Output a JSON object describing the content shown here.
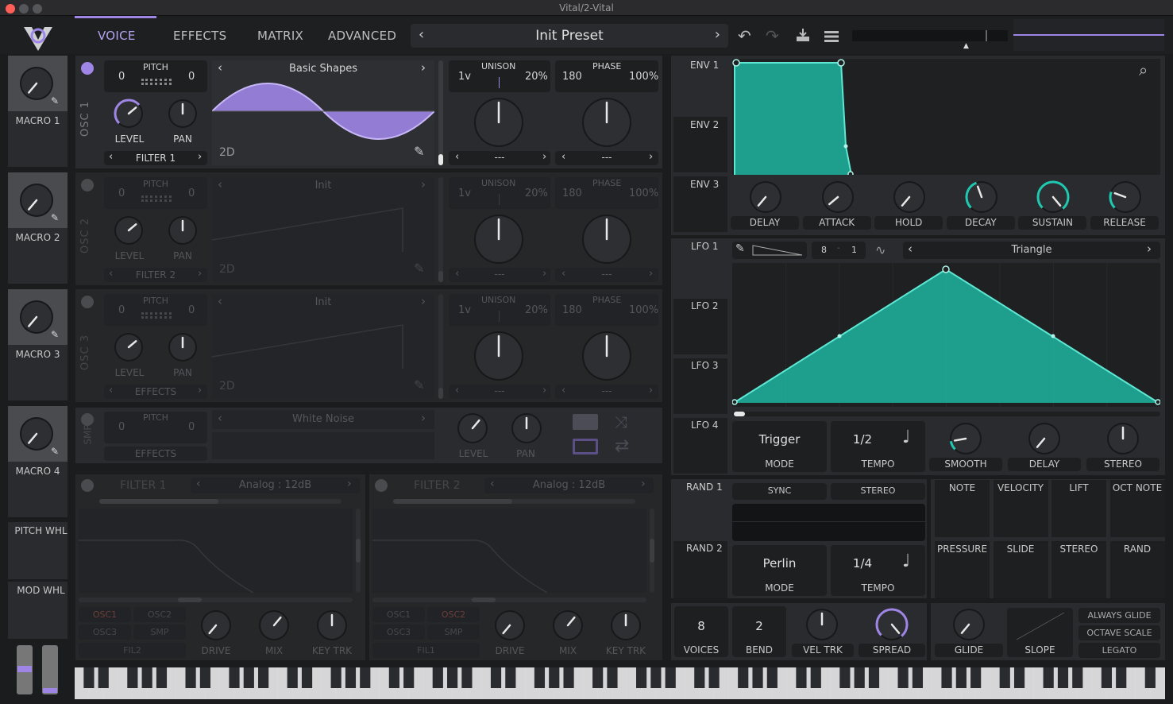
{
  "window": {
    "title": "Vital/2-Vital"
  },
  "nav": {
    "tabs": [
      "VOICE",
      "EFFECTS",
      "MATRIX",
      "ADVANCED"
    ],
    "active": "VOICE"
  },
  "preset": {
    "name": "Init Preset"
  },
  "macros": [
    "MACRO 1",
    "MACRO 2",
    "MACRO 3",
    "MACRO 4"
  ],
  "wheels": {
    "pitch": "PITCH WHL",
    "mod": "MOD WHL"
  },
  "osc": [
    {
      "id": "OSC 1",
      "pitch_label": "PITCH",
      "transpose": "0",
      "tune": "0",
      "wavetable": "Basic Shapes",
      "mode2d": "2D",
      "level": "LEVEL",
      "pan": "PAN",
      "dest": "FILTER 1",
      "unison_label": "UNISON",
      "voices": "1v",
      "detune": "20%",
      "phase_label": "PHASE",
      "phase": "180",
      "phase_rand": "100%",
      "spectral": "---",
      "distort": "---"
    },
    {
      "id": "OSC 2",
      "pitch_label": "PITCH",
      "transpose": "0",
      "tune": "0",
      "wavetable": "Init",
      "mode2d": "2D",
      "level": "LEVEL",
      "pan": "PAN",
      "dest": "FILTER 2",
      "unison_label": "UNISON",
      "voices": "1v",
      "detune": "20%",
      "phase_label": "PHASE",
      "phase": "180",
      "phase_rand": "100%",
      "spectral": "---",
      "distort": "---"
    },
    {
      "id": "OSC 3",
      "pitch_label": "PITCH",
      "transpose": "0",
      "tune": "0",
      "wavetable": "Init",
      "mode2d": "2D",
      "level": "LEVEL",
      "pan": "PAN",
      "dest": "EFFECTS",
      "unison_label": "UNISON",
      "voices": "1v",
      "detune": "20%",
      "phase_label": "PHASE",
      "phase": "180",
      "phase_rand": "100%",
      "spectral": "---",
      "distort": "---"
    }
  ],
  "smp": {
    "id": "SMP",
    "pitch_label": "PITCH",
    "transpose": "0",
    "tune": "0",
    "sample": "White Noise",
    "dest": "EFFECTS",
    "level": "LEVEL",
    "pan": "PAN"
  },
  "filters": [
    {
      "title": "FILTER 1",
      "model": "Analog : 12dB",
      "src": [
        "OSC1",
        "OSC2",
        "OSC3",
        "SMP"
      ],
      "route": "FIL2",
      "knobs": [
        "DRIVE",
        "MIX",
        "KEY TRK"
      ]
    },
    {
      "title": "FILTER 2",
      "model": "Analog : 12dB",
      "src": [
        "OSC1",
        "OSC2",
        "OSC3",
        "SMP"
      ],
      "route": "FIL1",
      "knobs": [
        "DRIVE",
        "MIX",
        "KEY TRK"
      ]
    }
  ],
  "env": {
    "tabs": [
      "ENV 1",
      "ENV 2",
      "ENV 3"
    ],
    "knobs": [
      "DELAY",
      "ATTACK",
      "HOLD",
      "DECAY",
      "SUSTAIN",
      "RELEASE"
    ]
  },
  "lfo": {
    "tabs": [
      "LFO 1",
      "LFO 2",
      "LFO 3",
      "LFO 4"
    ],
    "grid_x": "8",
    "grid_y": "1",
    "shape": "Triangle",
    "trigger": "Trigger",
    "mode_label": "MODE",
    "tempo": "1/2",
    "tempo_label": "TEMPO",
    "knobs": [
      "SMOOTH",
      "DELAY",
      "STEREO"
    ]
  },
  "rand": {
    "tabs": [
      "RAND 1",
      "RAND 2"
    ],
    "sync": "SYNC",
    "stereo": "STEREO",
    "type": "Perlin",
    "mode_label": "MODE",
    "tempo": "1/4",
    "tempo_label": "TEMPO"
  },
  "mods": [
    "NOTE",
    "VELOCITY",
    "LIFT",
    "OCT NOTE",
    "PRESSURE",
    "SLIDE",
    "STEREO",
    "RAND"
  ],
  "voice": {
    "voices": "8",
    "voices_label": "VOICES",
    "bend": "2",
    "bend_label": "BEND",
    "vel": "VEL TRK",
    "spread": "SPREAD"
  },
  "glide": {
    "glide": "GLIDE",
    "slope": "SLOPE",
    "options": [
      "ALWAYS GLIDE",
      "OCTAVE SCALE",
      "LEGATO"
    ]
  },
  "colors": {
    "accent": "#9f86e6",
    "env": "#1fc8b0",
    "bg": "#1b1c1e",
    "panel": "#2a2b2e"
  }
}
